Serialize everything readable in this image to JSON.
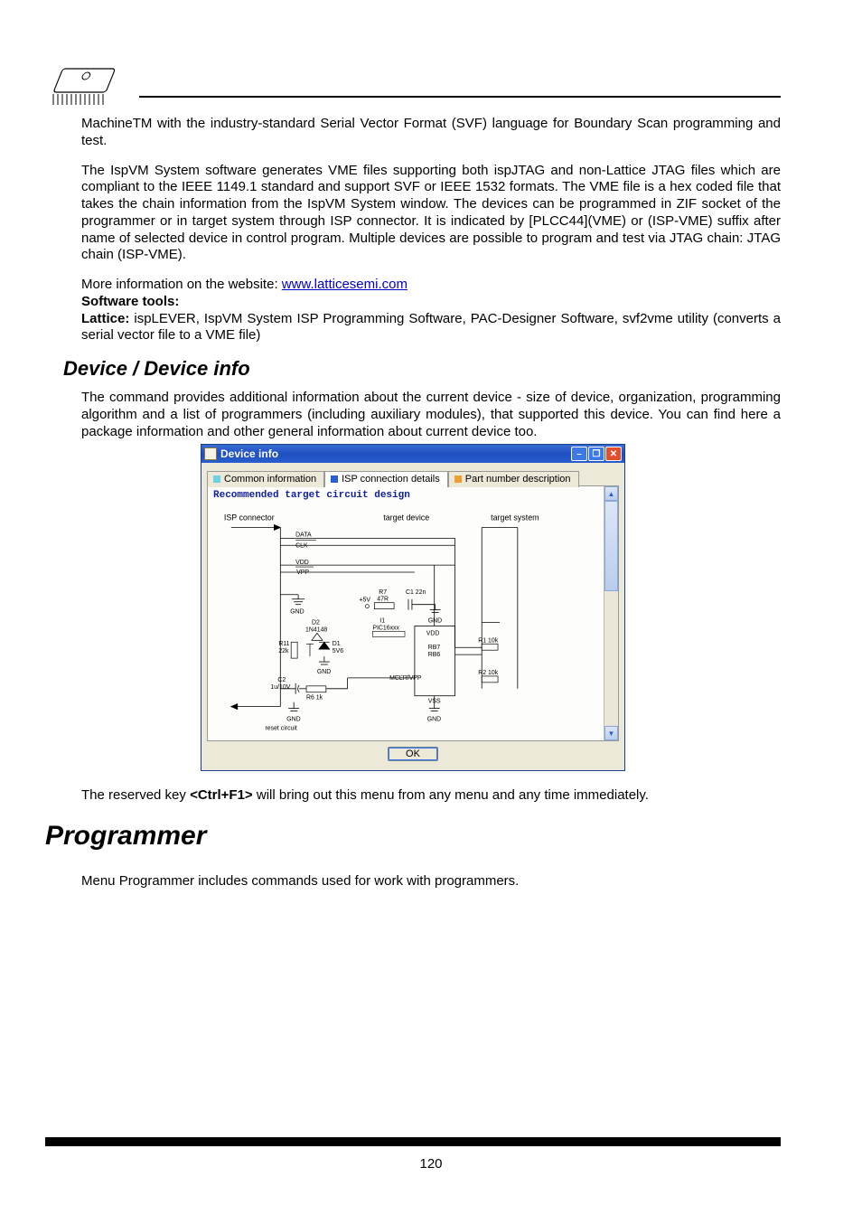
{
  "body": {
    "p1": "MachineTM with the industry-standard Serial Vector Format (SVF) language for Boundary Scan programming and test.",
    "p2": "The IspVM System software generates VME files supporting both ispJTAG and non-Lattice JTAG files which are compliant to the IEEE 1149.1 standard and support SVF or IEEE 1532 formats. The VME file is a hex coded file that takes the chain information from the IspVM System window. The devices can be programmed in ZIF socket of the programmer or in target system through ISP connector. It is indicated by [PLCC44](VME) or (ISP-VME) suffix after name of selected device in control program. Multiple devices are possible to program and test via JTAG chain: JTAG chain (ISP-VME).",
    "more_info_pre": "More information on the website:   ",
    "more_info_link": "www.latticesemi.com",
    "software_tools_label": "Software tools:",
    "lattice_label": "Lattice:",
    "lattice_rest": " ispLEVER, IspVM System ISP Programming Software, PAC-Designer Software, svf2vme utility (converts a serial vector file to a VME file)"
  },
  "section_device": {
    "heading": "Device / Device info",
    "p1": "The command provides additional information about the current device - size of device, organization, programming algorithm and a list of programmers (including auxiliary modules), that supported this device. You can find here a package information and other general information about current device too.",
    "p2_pre": "The reserved key ",
    "p2_key": "<Ctrl+F1>",
    "p2_post": " will bring out this menu from any menu and any time immediately."
  },
  "section_programmer": {
    "heading": "Programmer",
    "p1": "Menu Programmer includes commands used for work with programmers."
  },
  "dialog": {
    "title": "Device info",
    "tabs": {
      "t1": "Common information",
      "t2": "ISP connection details",
      "t3": "Part number description"
    },
    "panel_heading": "Recommended target circuit design",
    "labels": {
      "isp_connector": "ISP connector",
      "target_device": "target device",
      "target_system": "target system",
      "data": "DATA",
      "clk": "CLK",
      "vdd": "VDD",
      "vpp": "VPP",
      "gnd1": "GND",
      "p5v": "+5V",
      "r7": "R7",
      "r7v": "47R",
      "c1": "C1  22n",
      "gnd2": "GND",
      "i1": "I1",
      "pic": "PIC16xxx",
      "d2": "D2",
      "d2v": "1N4148",
      "r11": "R11",
      "r11v": "22k",
      "d1": "D1",
      "d1v": "5V6",
      "gnd3": "GND",
      "c2": "C2",
      "c2v": "1u/10V",
      "r6": "R6  1k",
      "gnd4": "GND",
      "vdd2": "VDD",
      "rb7": "RB7",
      "rb6": "RB6",
      "mclr": "MCLR/VPP",
      "vss": "VSS",
      "gnd5": "GND",
      "r1": "R1  10k",
      "r2": "R2  10k",
      "reset": "reset circuit"
    },
    "ok": "OK",
    "scroll_up": "▲",
    "scroll_down": "▼"
  },
  "page_number": "120"
}
